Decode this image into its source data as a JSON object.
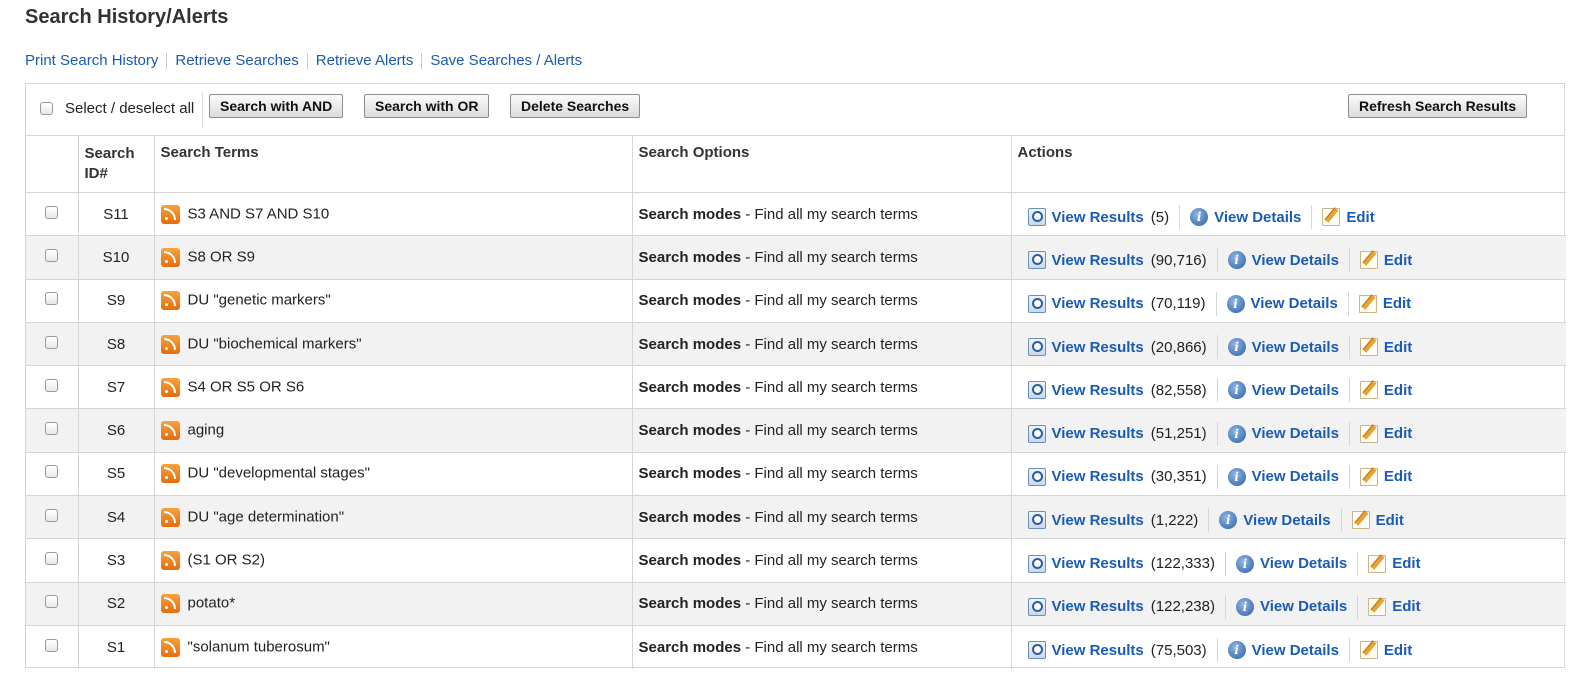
{
  "page_title": "Search History/Alerts",
  "top_links": [
    "Print Search History",
    "Retrieve Searches",
    "Retrieve Alerts",
    "Save Searches / Alerts"
  ],
  "toolbar": {
    "select_all_label": "Select / deselect all",
    "search_and_label": "Search with AND",
    "search_or_label": "Search with OR",
    "delete_label": "Delete Searches",
    "refresh_label": "Refresh Search Results"
  },
  "table": {
    "headers": {
      "id_line1": "Search",
      "id_line2": "ID#",
      "terms": "Search Terms",
      "options": "Search Options",
      "actions": "Actions"
    },
    "option_label": "Search modes",
    "option_value": " - Find all my search terms",
    "view_results_label": "View Results",
    "view_details_label": "View Details",
    "edit_label": "Edit",
    "rows": [
      {
        "id": "S11",
        "terms": "S3 AND S7 AND S10",
        "count": "(5)"
      },
      {
        "id": "S10",
        "terms": "S8 OR S9",
        "count": "(90,716)"
      },
      {
        "id": "S9",
        "terms": "DU \"genetic markers\"",
        "count": "(70,119)"
      },
      {
        "id": "S8",
        "terms": "DU \"biochemical markers\"",
        "count": "(20,866)"
      },
      {
        "id": "S7",
        "terms": "S4 OR S5 OR S6",
        "count": "(82,558)"
      },
      {
        "id": "S6",
        "terms": "aging",
        "count": "(51,251)"
      },
      {
        "id": "S5",
        "terms": "DU \"developmental stages\"",
        "count": "(30,351)"
      },
      {
        "id": "S4",
        "terms": "DU \"age determination\"",
        "count": "(1,222)"
      },
      {
        "id": "S3",
        "terms": "(S1 OR S2)",
        "count": "(122,333)"
      },
      {
        "id": "S2",
        "terms": "potato*",
        "count": "(122,238)"
      },
      {
        "id": "S1",
        "terms": "\"solanum tuberosum\"",
        "count": "(75,503)"
      }
    ]
  }
}
